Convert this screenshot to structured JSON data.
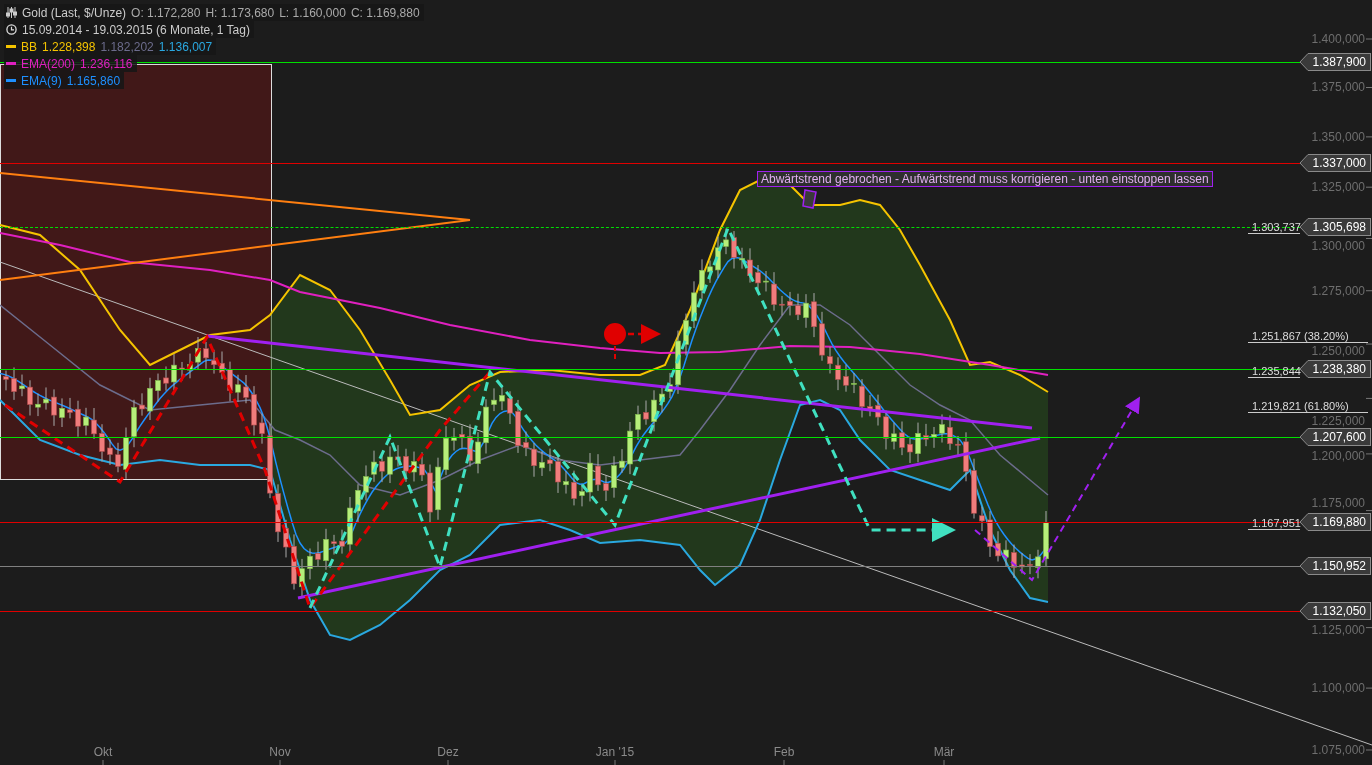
{
  "legend": {
    "instrument": "Gold (Last, $/Unze)",
    "ohlc": [
      "O: 1.172,280",
      "H: 1.173,680",
      "L: 1.160,000",
      "C: 1.169,880"
    ],
    "range": "15.09.2014 - 19.03.2015 (6 Monate, 1 Tag)",
    "indicators": [
      {
        "name": "BB",
        "color": "#f5c400",
        "values": [
          {
            "text": "1.228,398",
            "color": "#f5c400"
          },
          {
            "text": "1.182,202",
            "color": "#6c6c8c"
          },
          {
            "text": "1.136,007",
            "color": "#2aa8e0"
          }
        ]
      },
      {
        "name": "EMA(200)",
        "color": "#e020c0",
        "values": [
          {
            "text": "1.236,116",
            "color": "#e020c0"
          }
        ]
      },
      {
        "name": "EMA(9)",
        "color": "#1e90ff",
        "values": [
          {
            "text": "1.165,860",
            "color": "#1e90ff"
          }
        ]
      }
    ]
  },
  "annotation": "Abwärtstrend gebrochen - Aufwärtstrend muss korrigieren - unten einstoppen lassen",
  "y_axis": {
    "ticks": [
      "1.400,000",
      "1.375,000",
      "1.350,000",
      "1.325,000",
      "1.300,000",
      "1.275,000",
      "1.250,000",
      "1.225,000",
      "1.200,000",
      "1.175,000",
      "1.125,000",
      "1.100,000",
      "1.075,000"
    ]
  },
  "x_axis": {
    "ticks": [
      "Okt",
      "Nov",
      "Dez",
      "Jan '15",
      "Feb",
      "Mär"
    ]
  },
  "fib_labels": [
    "1.303,737",
    "1.251,867 (38.20%)",
    "1.235,844",
    "1.219,821 (61.80%)",
    "1.167,951"
  ],
  "price_levels": [
    {
      "text": "1.387,900",
      "color": "#00e000",
      "kind": "solid"
    },
    {
      "text": "1.337,000",
      "color": "#e00000",
      "kind": "solid"
    },
    {
      "text": "1.305,698",
      "color": "#00e000",
      "kind": "dashed"
    },
    {
      "text": "1.238,380",
      "color": "#00e000",
      "kind": "solid"
    },
    {
      "text": "1.207,600",
      "color": "#00e000",
      "kind": "solid"
    },
    {
      "text": "1.169,880",
      "color": "#e00000",
      "kind": "solid"
    },
    {
      "text": "1.150,952",
      "color": "#808080",
      "kind": "solid"
    },
    {
      "text": "1.132,050",
      "color": "#e00000",
      "kind": "solid"
    }
  ]
}
